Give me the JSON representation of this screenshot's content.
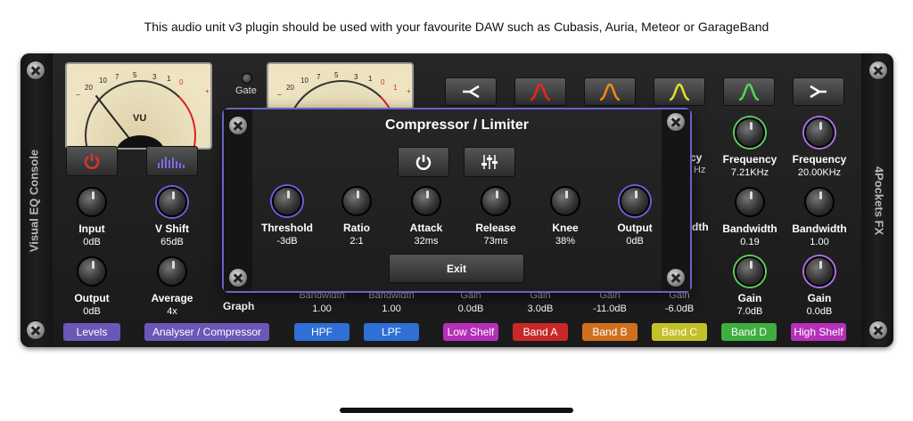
{
  "caption": "This audio unit v3 plugin should be used with your favourite DAW such as Cubasis, Auria, Meteor or GarageBand",
  "left_rail_label": "Visual EQ Console",
  "right_rail_label": "4Pockets FX",
  "vu": {
    "label": "VU",
    "scale": [
      "20",
      "10",
      "7",
      "5",
      "3",
      "1",
      "0",
      "1",
      "2",
      "3"
    ],
    "minus": "−",
    "plus": "+"
  },
  "gate_label": "Gate",
  "graph_label": "Graph",
  "left_controls": [
    {
      "label": "Input",
      "value": "0dB"
    },
    {
      "label": "V Shift",
      "value": "65dB"
    },
    {
      "label": "Output",
      "value": "0dB"
    },
    {
      "label": "Average",
      "value": "4x"
    }
  ],
  "right_controls": {
    "partial_frequency": "ency",
    "partial_frequency_value": "Hz",
    "partial_bandwidth": "dth",
    "band_d": {
      "freq_label": "Frequency",
      "freq_value": "7.21KHz",
      "bw_label": "Bandwidth",
      "bw_value": "0.19",
      "gain_label": "Gain",
      "gain_value": "7.0dB"
    },
    "high_shelf": {
      "freq_label": "Frequency",
      "freq_value": "20.00KHz",
      "bw_label": "Bandwidth",
      "bw_value": "1.00",
      "gain_label": "Gain",
      "gain_value": "0.0dB"
    }
  },
  "bottom_values": [
    {
      "label": "Bandwidth",
      "value": "1.00"
    },
    {
      "label": "Bandwidth",
      "value": "1.00"
    },
    {
      "label": "Gain",
      "value": "0.0dB"
    },
    {
      "label": "Gain",
      "value": "3.0dB"
    },
    {
      "label": "Gain",
      "value": "-11.0dB"
    },
    {
      "label": "Gain",
      "value": "-6.0dB"
    }
  ],
  "tags": [
    {
      "label": "Levels",
      "color": "#6a57b8"
    },
    {
      "label": "Analyser / Compressor",
      "color": "#6a57b8"
    },
    {
      "label": "HPF",
      "color": "#2f6fd6"
    },
    {
      "label": "LPF",
      "color": "#2f6fd6"
    },
    {
      "label": "Low Shelf",
      "color": "#b52fb8"
    },
    {
      "label": "Band A",
      "color": "#c82828"
    },
    {
      "label": "Band B",
      "color": "#d0701c"
    },
    {
      "label": "Band C",
      "color": "#c4c02a"
    },
    {
      "label": "Band D",
      "color": "#3fae3f"
    },
    {
      "label": "High Shelf",
      "color": "#b52fb8"
    }
  ],
  "filter_icons": [
    {
      "name": "hpf-icon",
      "color": "#ffffff"
    },
    {
      "name": "band-a-icon",
      "color": "#e02a2a"
    },
    {
      "name": "band-b-icon",
      "color": "#f08a1c"
    },
    {
      "name": "band-c-icon",
      "color": "#e6e02a"
    },
    {
      "name": "band-d-icon",
      "color": "#4fd84f"
    },
    {
      "name": "high-shelf-icon",
      "color": "#ffffff"
    }
  ],
  "compressor": {
    "title": "Compressor / Limiter",
    "exit_label": "Exit",
    "knobs": [
      {
        "label": "Threshold",
        "value": "-3dB"
      },
      {
        "label": "Ratio",
        "value": "2:1"
      },
      {
        "label": "Attack",
        "value": "32ms"
      },
      {
        "label": "Release",
        "value": "73ms"
      },
      {
        "label": "Knee",
        "value": "38%"
      },
      {
        "label": "Output",
        "value": "0dB"
      }
    ]
  }
}
